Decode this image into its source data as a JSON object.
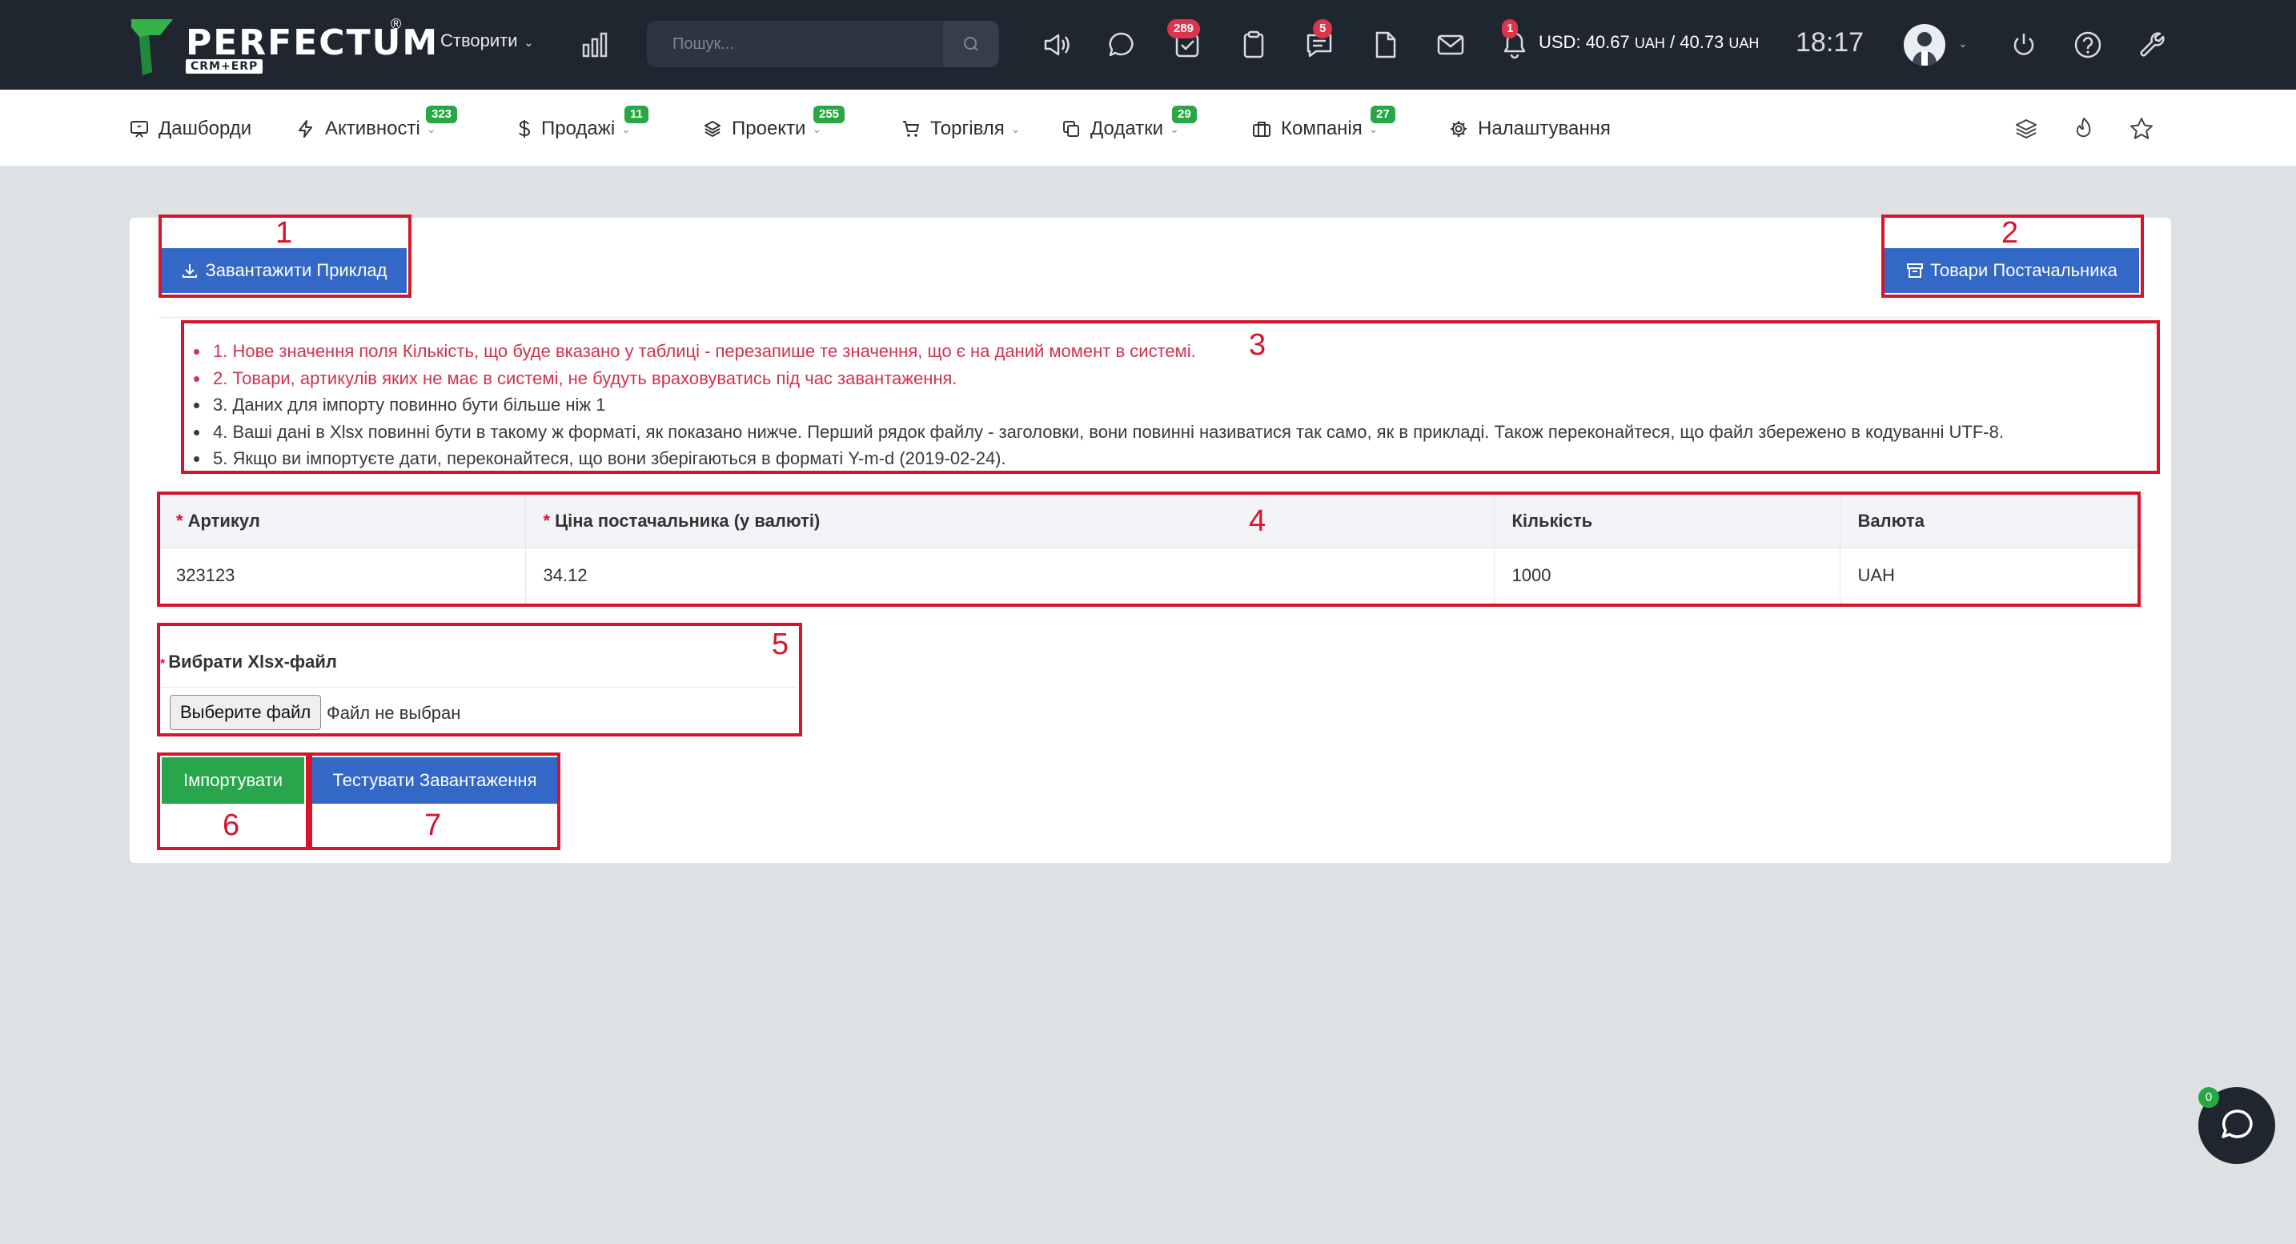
{
  "app": {
    "logo_text": "PERFECTUM",
    "logo_reg": "®",
    "logo_sub": "CRM+ERP"
  },
  "topbar": {
    "create_label": "Створити",
    "search_placeholder": "Пошук...",
    "tasks_badge": "289",
    "messages_badge": "5",
    "notifications_badge": "1",
    "rates_usd_label": "USD: ",
    "rate_1": "40.67",
    "rate_currency_1": "UAH",
    "rate_sep": " / ",
    "rate_2": "40.73",
    "rate_currency_2": "UAH",
    "time": "18:17"
  },
  "nav": {
    "items": [
      {
        "label": "Дашборди",
        "icon": "dashboard-icon"
      },
      {
        "label": "Активності",
        "badge": "323",
        "icon": "bolt-icon"
      },
      {
        "label": "Продажі",
        "badge": "11",
        "icon": "dollar-icon"
      },
      {
        "label": "Проекти",
        "badge": "255",
        "icon": "layers-icon"
      },
      {
        "label": "Торгівля",
        "icon": "cart-icon"
      },
      {
        "label": "Додатки",
        "badge": "29",
        "icon": "copy-icon"
      },
      {
        "label": "Компанія",
        "badge": "27",
        "icon": "briefcase-icon"
      },
      {
        "label": "Налаштування",
        "icon": "gear-icon"
      }
    ]
  },
  "page": {
    "download_example_label": "Завантажити Приклад",
    "supplier_goods_label": "Товари Постачальника",
    "rules": [
      "1. Нове значення поля Кількість, що буде вказано у таблиці - перезапише те значення, що є на даний момент в системі.",
      "2. Товари, артикулів яких не має в системі, не будуть враховуватись під час завантаження.",
      "3. Даних для імпорту повинно бути більше ніж 1",
      "4. Ваші дані в Xlsx повинні бути в такому ж форматі, як показано нижче. Перший рядок файлу - заголовки, вони повинні називатися так само, як в прикладі. Також переконайтеся, що файл збережено в кодуванні UTF-8.",
      "5. Якщо ви імпортуєте дати, переконайтеся, що вони зберігаються в форматі Y-m-d (2019-02-24)."
    ],
    "table": {
      "headers": [
        "Артикул",
        "Ціна постачальника (у валюті)",
        "Кількість",
        "Валюта"
      ],
      "required": [
        "*",
        "*",
        "",
        ""
      ],
      "row": [
        "323123",
        "34.12",
        "1000",
        "UAH"
      ]
    },
    "file_label": "Вибрати Xlsx-файл",
    "file_required": "*",
    "file_button": "Выберите файл",
    "file_status": "Файл не выбран",
    "import_label": "Імпортувати",
    "test_label": "Тестувати Завантаження"
  },
  "annotations": [
    "1",
    "2",
    "3",
    "4",
    "5",
    "6",
    "7"
  ],
  "chat": {
    "badge": "0"
  },
  "colors": {
    "topbar": "#1f2630",
    "primary": "#3468c6",
    "success": "#29a54b",
    "annotation": "#d7152a",
    "warning_text": "#d03250"
  }
}
